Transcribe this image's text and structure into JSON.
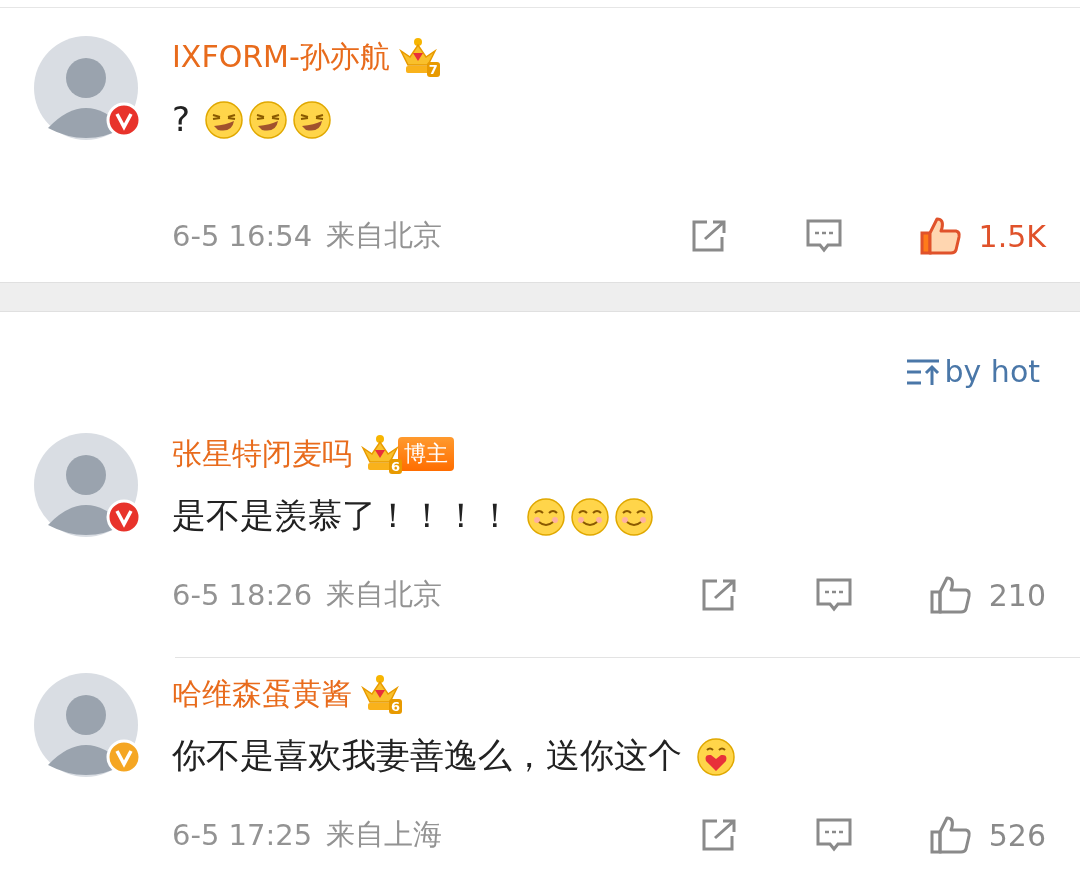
{
  "pinned": [
    {
      "user": "IXFORM-孙亦航",
      "level": "7",
      "color": "#e8332b",
      "content": "?",
      "emoji": [
        {
          "kind": "confused"
        },
        {
          "kind": "confused"
        },
        {
          "kind": "confused"
        }
      ],
      "time": "6-5 16:54",
      "location": "来自北京",
      "likes": "1.5K",
      "liked": true
    }
  ],
  "sort": {
    "label": "by hot"
  },
  "comments": [
    {
      "user": "张星特闭麦吗",
      "level": "6",
      "tag": "博主",
      "color": "#e8332b",
      "content": "是不是羡慕了！！！！",
      "emoji": [
        {
          "kind": "smug"
        },
        {
          "kind": "smug"
        },
        {
          "kind": "smug"
        }
      ],
      "time": "6-5 18:26",
      "location": "来自北京",
      "likes": "210",
      "liked": false
    },
    {
      "user": "哈维森蛋黄酱",
      "level": "6",
      "color": "#f5a623",
      "content": "你不是喜欢我妻善逸么，送你这个",
      "emoji": [
        {
          "kind": "hug"
        }
      ],
      "time": "6-5 17:25",
      "location": "来自上海",
      "likes": "526",
      "liked": false
    }
  ]
}
